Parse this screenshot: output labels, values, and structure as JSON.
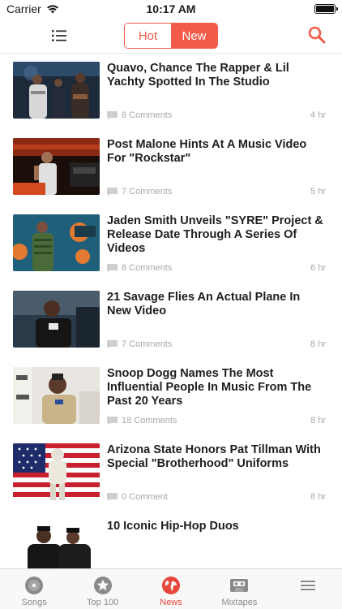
{
  "status_bar": {
    "carrier": "Carrier",
    "time": "10:17 AM"
  },
  "nav": {
    "segments": [
      {
        "label": "Hot"
      },
      {
        "label": "New"
      }
    ],
    "active_segment": "New",
    "accent_color": "#f25a4a"
  },
  "news": [
    {
      "title": "Quavo, Chance The Rapper & Lil Yachty Spotted In The Studio",
      "comments": "6 Comments",
      "time": "4 hr"
    },
    {
      "title": "Post Malone Hints At A Music Video For \"Rockstar\"",
      "comments": "7 Comments",
      "time": "5 hr"
    },
    {
      "title": "Jaden Smith Unveils \"SYRE\" Project & Release Date Through A Series Of Videos",
      "comments": "8 Comments",
      "time": "6 hr"
    },
    {
      "title": "21 Savage Flies An Actual Plane In New Video",
      "comments": "7 Comments",
      "time": "8 hr"
    },
    {
      "title": "Snoop Dogg Names The Most Influential People In Music From The Past 20 Years",
      "comments": "18 Comments",
      "time": "8 hr"
    },
    {
      "title": "Arizona State Honors Pat Tillman With Special \"Brotherhood\" Uniforms",
      "comments": "0 Comment",
      "time": "8 hr"
    },
    {
      "title": "10 Iconic Hip-Hop Duos",
      "comments": "",
      "time": ""
    }
  ],
  "tabs": [
    {
      "label": "Songs",
      "icon": "disc-icon"
    },
    {
      "label": "Top 100",
      "icon": "star-icon"
    },
    {
      "label": "News",
      "icon": "globe-icon"
    },
    {
      "label": "Mixtapes",
      "icon": "cassette-icon"
    },
    {
      "label": "",
      "icon": "menu-icon"
    }
  ],
  "active_tab": "News"
}
